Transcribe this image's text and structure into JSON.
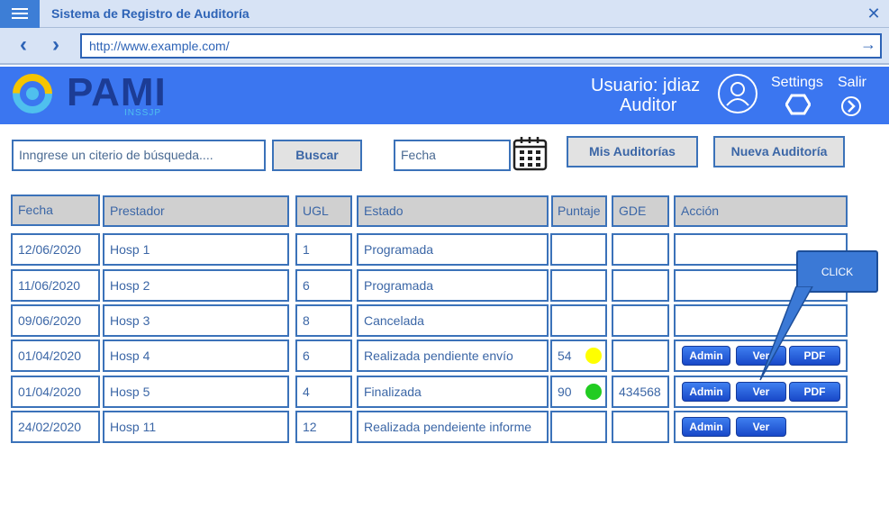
{
  "window": {
    "title": "Sistema de Registro de Auditoría"
  },
  "browser": {
    "url": "http://www.example.com/"
  },
  "header": {
    "logo_text": "PAMI",
    "logo_subtext": "INSSJP",
    "user_label": "Usuario: jdiaz",
    "role": "Auditor",
    "settings_label": "Settings",
    "logout_label": "Salir"
  },
  "search": {
    "placeholder": "Inngrese un citerio de búsqueda....",
    "search_button": "Buscar",
    "date_placeholder": "Fecha",
    "my_audits_button": "Mis Auditorías",
    "new_audit_button": "Nueva Auditoría"
  },
  "table": {
    "headers": [
      "Fecha",
      "Prestador",
      "UGL",
      "Estado",
      "Puntaje",
      "GDE",
      "Acción"
    ],
    "rows": [
      {
        "fecha": "12/06/2020",
        "prestador": "Hosp 1",
        "ugl": "1",
        "estado": "Programada",
        "puntaje": "",
        "gde": ""
      },
      {
        "fecha": "11/06/2020",
        "prestador": "Hosp 2",
        "ugl": "6",
        "estado": "Programada",
        "puntaje": "",
        "gde": ""
      },
      {
        "fecha": "09/06/2020",
        "prestador": "Hosp 3",
        "ugl": "8",
        "estado": "Cancelada",
        "puntaje": "",
        "gde": ""
      },
      {
        "fecha": "01/04/2020",
        "prestador": "Hosp 4",
        "ugl": "6",
        "estado": "Realizada pendiente envío",
        "puntaje": "54",
        "gde": ""
      },
      {
        "fecha": "01/04/2020",
        "prestador": "Hosp 5",
        "ugl": "4",
        "estado": "Finalizada",
        "puntaje": "90",
        "gde": "434568"
      },
      {
        "fecha": "24/02/2020",
        "prestador": "Hosp 11",
        "ugl": "12",
        "estado": "Realizada pendeiente informe",
        "puntaje": "",
        "gde": ""
      }
    ],
    "action_labels": {
      "admin": "Admin",
      "ver": "Ver",
      "pdf": "PDF"
    }
  },
  "callout": {
    "text": "CLICK"
  },
  "colors": {
    "header_bg": "#3b76f0",
    "table_border": "#3b72b9",
    "score_yellow": "#ffff00",
    "score_green": "#22cc22",
    "button_blue": "#2a5ee0"
  }
}
